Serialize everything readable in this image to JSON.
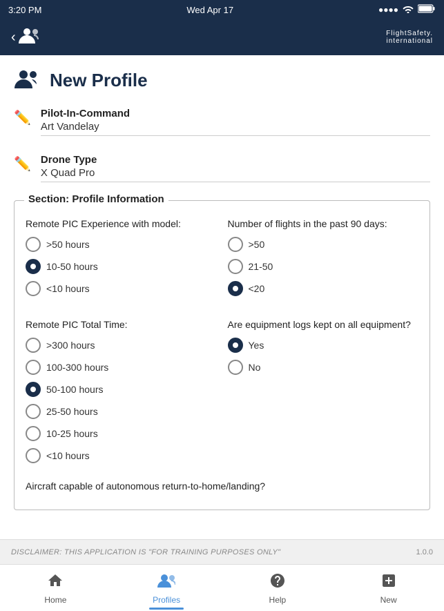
{
  "statusBar": {
    "time": "3:20 PM",
    "date": "Wed Apr 17",
    "signal": "●●●●",
    "wifi": "wifi",
    "battery": "100%"
  },
  "navBar": {
    "backIcon": "‹",
    "logoLine1": "FlightSafety.",
    "logoLine2": "international"
  },
  "pageTitle": "New Profile",
  "fields": {
    "pilotLabel": "Pilot-In-Command",
    "pilotValue": "Art Vandelay",
    "droneLabel": "Drone Type",
    "droneValue": "X Quad Pro"
  },
  "profileSection": {
    "title": "Section: Profile Information",
    "col1": {
      "label": "Remote PIC Experience with model:",
      "options": [
        {
          "id": "exp-gt50",
          "label": ">50 hours",
          "selected": false
        },
        {
          "id": "exp-10-50",
          "label": "10-50 hours",
          "selected": true
        },
        {
          "id": "exp-lt10",
          "label": "<10 hours",
          "selected": false
        }
      ]
    },
    "col2": {
      "label": "Number of flights in the past 90 days:",
      "options": [
        {
          "id": "flights-gt50",
          "label": ">50",
          "selected": false
        },
        {
          "id": "flights-21-50",
          "label": "21-50",
          "selected": false
        },
        {
          "id": "flights-lt20",
          "label": "<20",
          "selected": true
        }
      ]
    },
    "col3": {
      "label": "Remote PIC Total Time:",
      "options": [
        {
          "id": "total-gt300",
          "label": ">300 hours",
          "selected": false
        },
        {
          "id": "total-100-300",
          "label": "100-300 hours",
          "selected": false
        },
        {
          "id": "total-50-100",
          "label": "50-100 hours",
          "selected": true
        },
        {
          "id": "total-25-50",
          "label": "25-50 hours",
          "selected": false
        },
        {
          "id": "total-10-25",
          "label": "10-25 hours",
          "selected": false
        },
        {
          "id": "total-lt10",
          "label": "<10 hours",
          "selected": false
        }
      ]
    },
    "col4": {
      "label": "Are equipment logs kept on all equipment?",
      "options": [
        {
          "id": "logs-yes",
          "label": "Yes",
          "selected": true
        },
        {
          "id": "logs-no",
          "label": "No",
          "selected": false
        }
      ]
    },
    "autonomousLabel": "Aircraft capable of autonomous return-to-home/landing?"
  },
  "disclaimer": "DISCLAIMER: THIS APPLICATION IS \"FOR TRAINING PURPOSES ONLY\"",
  "version": "1.0.0",
  "bottomNav": [
    {
      "id": "home",
      "icon": "⌂",
      "label": "Home",
      "active": false
    },
    {
      "id": "profiles",
      "icon": "👥",
      "label": "Profiles",
      "active": true
    },
    {
      "id": "help",
      "icon": "?",
      "label": "Help",
      "active": false
    },
    {
      "id": "new",
      "icon": "+",
      "label": "New",
      "active": false
    }
  ]
}
